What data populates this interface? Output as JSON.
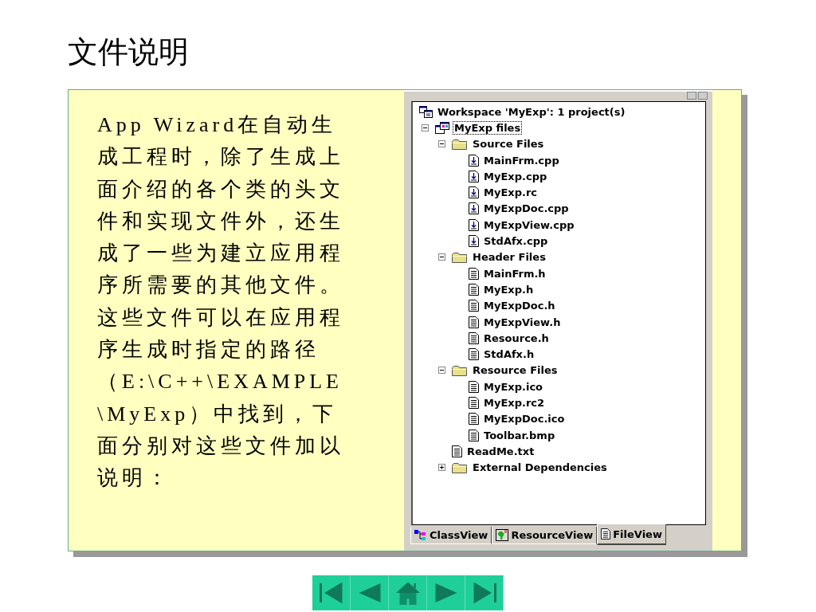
{
  "title": "文件说明",
  "description": "App Wizard在自动生成工程时，除了生成上面介绍的各个类的头文件和实现文件外，还生成了一些为建立应用程序所需要的其他文件。这些文件可以在应用程序生成时指定的路径（E:\\C++\\EXAMPLE\\MyExp）中找到，下面分别对这些文件加以说明：",
  "tree": [
    {
      "label": "Workspace 'MyExp': 1 project(s)",
      "kind": "workspace",
      "selected": false,
      "children": [
        {
          "label": "MyExp files",
          "kind": "project",
          "expanded": true,
          "selected": true,
          "children": [
            {
              "label": "Source Files",
              "kind": "folder",
              "expanded": true,
              "selected": false,
              "children": [
                {
                  "label": "MainFrm.cpp",
                  "kind": "source",
                  "selected": false
                },
                {
                  "label": "MyExp.cpp",
                  "kind": "source",
                  "selected": false
                },
                {
                  "label": "MyExp.rc",
                  "kind": "source",
                  "selected": false
                },
                {
                  "label": "MyExpDoc.cpp",
                  "kind": "source",
                  "selected": false
                },
                {
                  "label": "MyExpView.cpp",
                  "kind": "source",
                  "selected": false
                },
                {
                  "label": "StdAfx.cpp",
                  "kind": "source",
                  "selected": false
                }
              ]
            },
            {
              "label": "Header Files",
              "kind": "folder",
              "expanded": true,
              "selected": false,
              "children": [
                {
                  "label": "MainFrm.h",
                  "kind": "file",
                  "selected": false
                },
                {
                  "label": "MyExp.h",
                  "kind": "file",
                  "selected": false
                },
                {
                  "label": "MyExpDoc.h",
                  "kind": "file",
                  "selected": false
                },
                {
                  "label": "MyExpView.h",
                  "kind": "file",
                  "selected": false
                },
                {
                  "label": "Resource.h",
                  "kind": "file",
                  "selected": false
                },
                {
                  "label": "StdAfx.h",
                  "kind": "file",
                  "selected": false
                }
              ]
            },
            {
              "label": "Resource Files",
              "kind": "folder",
              "expanded": true,
              "selected": false,
              "children": [
                {
                  "label": "MyExp.ico",
                  "kind": "file",
                  "selected": false
                },
                {
                  "label": "MyExp.rc2",
                  "kind": "file",
                  "selected": false
                },
                {
                  "label": "MyExpDoc.ico",
                  "kind": "file",
                  "selected": false
                },
                {
                  "label": "Toolbar.bmp",
                  "kind": "file",
                  "selected": false
                }
              ]
            },
            {
              "label": "ReadMe.txt",
              "kind": "file",
              "selected": false
            },
            {
              "label": "External Dependencies",
              "kind": "folder",
              "expanded": false,
              "selected": false
            }
          ]
        }
      ]
    }
  ],
  "tabs": [
    {
      "label": "ClassView",
      "kind": "class",
      "selected": false
    },
    {
      "label": "ResourceView",
      "kind": "resource",
      "selected": false
    },
    {
      "label": "FileView",
      "kind": "file",
      "selected": true
    }
  ],
  "nav": [
    {
      "kind": "first"
    },
    {
      "kind": "prev"
    },
    {
      "kind": "home"
    },
    {
      "kind": "next"
    },
    {
      "kind": "last"
    }
  ]
}
